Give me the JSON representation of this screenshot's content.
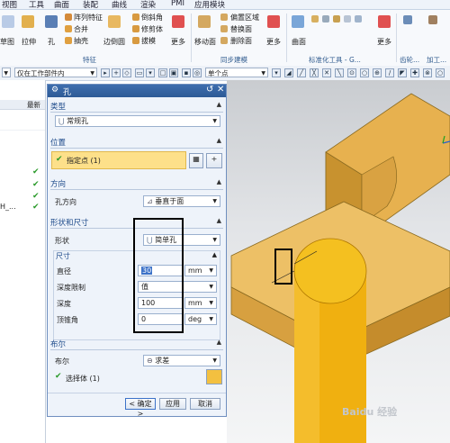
{
  "menu": [
    "视图",
    "工具",
    "曲面",
    "装配",
    "曲线",
    "渲染",
    "PMI",
    "应用模块"
  ],
  "ribbon": {
    "create_face_label": "草图",
    "extrude_label": "拉伸",
    "hole_label": "孔",
    "array_feature_label": "阵列特征",
    "combine_label": "合并",
    "shell_label": "抽壳",
    "edge_blend_label": "边倒圆",
    "chamfer_label": "倒斜角",
    "trim_body_label": "修剪体",
    "draft_label": "拔模",
    "more_label": "更多",
    "move_face_label": "移动面",
    "offset_region_label": "偏置区域",
    "replace_face_label": "替换面",
    "delete_face_label": "删除面",
    "more2_label": "更多",
    "surface_label": "曲面",
    "more3_label": "更多",
    "group_feature": "特征",
    "group_sync": "同步建模",
    "group_std": "标准化工具 - G...",
    "group_tool": "齿轮...",
    "group_process": "加工..."
  },
  "selbar": {
    "filter_value": "仅在工作部件内",
    "snap_value": "单个点"
  },
  "nav": {
    "column_header": "最新",
    "row_label": "H_..."
  },
  "dialog": {
    "title": "孔",
    "type_section": "类型",
    "type_value": "常规孔",
    "position_section": "位置",
    "specify_point_label": "指定点 (1)",
    "direction_section": "方向",
    "hole_direction_label": "孔方向",
    "hole_direction_value": "垂直于面",
    "shape_section": "形状和尺寸",
    "form_label": "形状",
    "form_value": "简单孔",
    "dimension_section": "尺寸",
    "diameter_label": "直径",
    "diameter_value": "30",
    "diameter_unit": "mm",
    "depth_limit_label": "深度限制",
    "depth_limit_value": "值",
    "depth_label": "深度",
    "depth_value": "100",
    "depth_unit": "mm",
    "tip_angle_label": "顶锥角",
    "tip_angle_value": "0",
    "tip_angle_unit": "deg",
    "boolean_section": "布尔",
    "boolean_label": "布尔",
    "boolean_value": "求差",
    "select_body_label": "选择体 (1)",
    "ok_label": "< 确定 >",
    "apply_label": "应用",
    "cancel_label": "取消"
  },
  "watermark": "Baidu 经验",
  "colors": {
    "dialog_title_bg": "#2d5a96",
    "highlight_row": "#fde08a",
    "model_face": "#e8b04e",
    "cylinder": "#f0b010",
    "annotation_box": "#000000"
  }
}
